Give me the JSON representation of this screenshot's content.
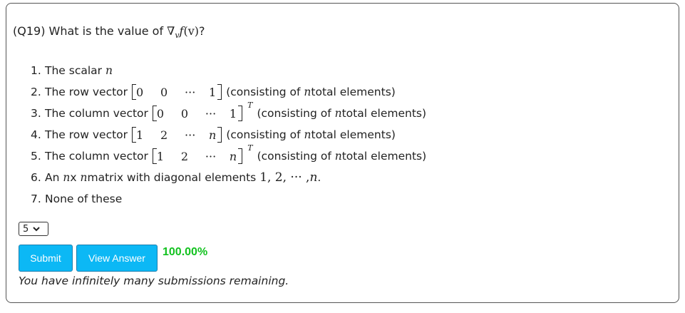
{
  "question": {
    "prefix": "(Q19) What is the value of ",
    "nabla": "∇",
    "sub_v": "v",
    "f": "f",
    "arg": "(v)",
    "suffix": "?"
  },
  "options": [
    {
      "num": "1.",
      "text": "The scalar ",
      "var": "n"
    },
    {
      "num": "2.",
      "text": "The row vector ",
      "cells": [
        "0",
        "0",
        "···",
        "1"
      ],
      "transpose": "",
      "note_pre": " (consisting of ",
      "note_var": "n",
      "note_post": " total elements)"
    },
    {
      "num": "3.",
      "text": "The column vector ",
      "cells": [
        "0",
        "0",
        "···",
        "1"
      ],
      "transpose": "T",
      "note_pre": " (consisting of ",
      "note_var": "n",
      "note_post": " total elements)"
    },
    {
      "num": "4.",
      "text": "The row vector ",
      "cells": [
        "1",
        "2",
        "···",
        "n"
      ],
      "transpose": "",
      "note_pre": " (consisting of ",
      "note_var": "n",
      "note_post": " total elements)"
    },
    {
      "num": "5.",
      "text": "The column vector ",
      "cells": [
        "1",
        "2",
        "···",
        "n"
      ],
      "transpose": "T",
      "note_pre": " (consisting of ",
      "note_var": "n",
      "note_post": " total elements)"
    },
    {
      "num": "6.",
      "text_a": "An ",
      "var_a": "n",
      "text_b": " x ",
      "var_b": "n",
      "text_c": " matrix with diagonal elements ",
      "seq": "1, 2, ··· , ",
      "seq_end": "n",
      "end": "."
    },
    {
      "num": "7.",
      "text": "None of these"
    }
  ],
  "answer_select": {
    "value": "5"
  },
  "buttons": {
    "submit": "Submit",
    "view_answer": "View Answer"
  },
  "score": "100.00%",
  "remaining": "You have infinitely many submissions remaining."
}
